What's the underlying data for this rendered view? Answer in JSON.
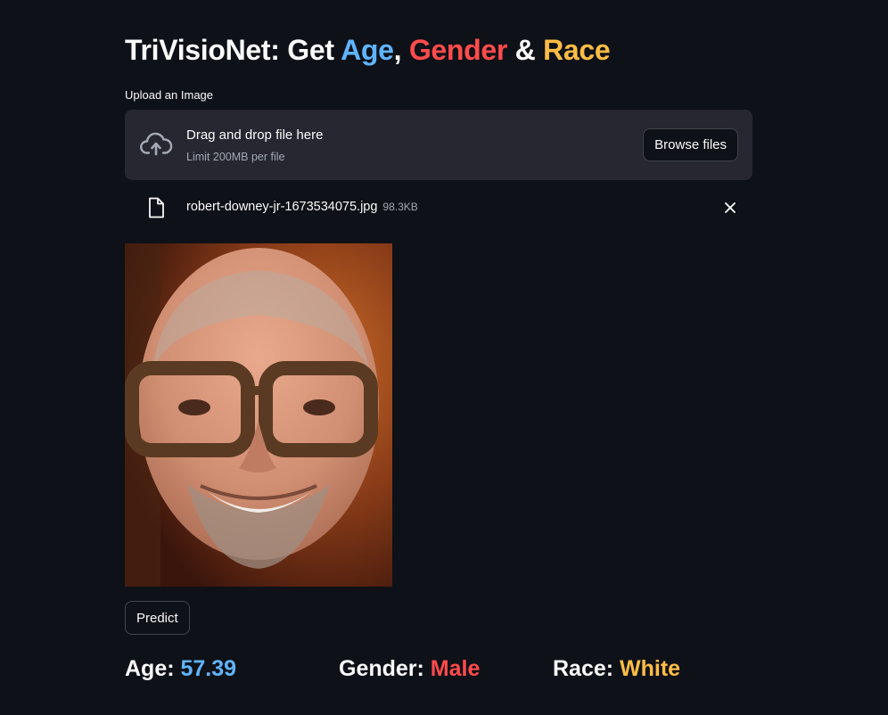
{
  "title": {
    "prefix": "TriVisioNet: Get ",
    "age": "Age",
    "comma": ", ",
    "gender": "Gender",
    "amp": " & ",
    "race": "Race"
  },
  "uploader": {
    "label": "Upload an Image",
    "drop_text": "Drag and drop file here",
    "limit_text": "Limit 200MB per file",
    "browse_label": "Browse files",
    "cloud_icon": "cloud-upload-icon"
  },
  "file": {
    "name": "robert-downey-jr-1673534075.jpg",
    "size": "98.3KB",
    "file_icon": "file-icon",
    "close_icon": "close-icon"
  },
  "predict_label": "Predict",
  "results": {
    "age_label": "Age: ",
    "age_value": "57.39",
    "gender_label": "Gender: ",
    "gender_value": "Male",
    "race_label": "Race: ",
    "race_value": "White"
  },
  "colors": {
    "background": "#0e1117",
    "age": "#60b4ff",
    "gender": "#ff4b4b",
    "race": "#ffbd45",
    "panel": "#262730"
  }
}
